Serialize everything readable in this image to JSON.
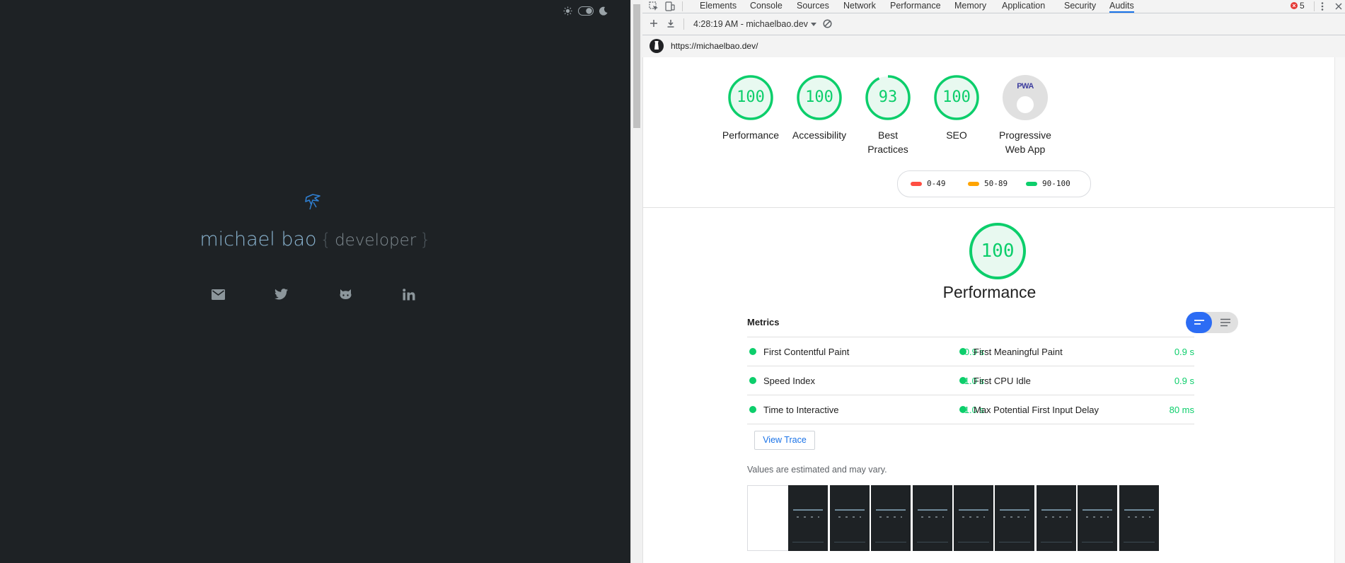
{
  "site": {
    "name": "michael bao",
    "brace_open": "{",
    "role": "developer",
    "brace_close": "}",
    "icons": [
      "sun-icon",
      "toggle-switch-icon",
      "moon-icon",
      "logo-icon",
      "mail-icon",
      "twitter-icon",
      "github-icon",
      "linkedin-icon"
    ]
  },
  "devtools": {
    "tabs": [
      "Elements",
      "Console",
      "Sources",
      "Network",
      "Performance",
      "Memory",
      "Application",
      "Security",
      "Audits"
    ],
    "active_tab": "Audits",
    "error_count": "5",
    "run_label": "4:28:19 AM - michaelbao.dev",
    "url": "https://michaelbao.dev/"
  },
  "report": {
    "categories": [
      {
        "label": "Performance",
        "score": "100"
      },
      {
        "label": "Accessibility",
        "score": "100"
      },
      {
        "label": "Best Practices",
        "score": "93"
      },
      {
        "label": "SEO",
        "score": "100"
      },
      {
        "label": "Progressive Web App",
        "badge": "PWA"
      }
    ],
    "legend": [
      {
        "range": "0-49",
        "color": "#ff4e42"
      },
      {
        "range": "50-89",
        "color": "#ffa400"
      },
      {
        "range": "90-100",
        "color": "#0cce6b"
      }
    ],
    "performance": {
      "score": "100",
      "title": "Performance",
      "metrics_heading": "Metrics",
      "metrics": [
        {
          "name": "First Contentful Paint",
          "value": "0.9 s"
        },
        {
          "name": "First Meaningful Paint",
          "value": "0.9 s"
        },
        {
          "name": "Speed Index",
          "value": "1.0 s"
        },
        {
          "name": "First CPU Idle",
          "value": "0.9 s"
        },
        {
          "name": "Time to Interactive",
          "value": "1.0 s"
        },
        {
          "name": "Max Potential First Input Delay",
          "value": "80 ms"
        }
      ],
      "view_trace": "View Trace",
      "note": "Values are estimated and may vary."
    },
    "colors": {
      "pass": "#0cce6b",
      "accent": "#1a73e8"
    }
  }
}
